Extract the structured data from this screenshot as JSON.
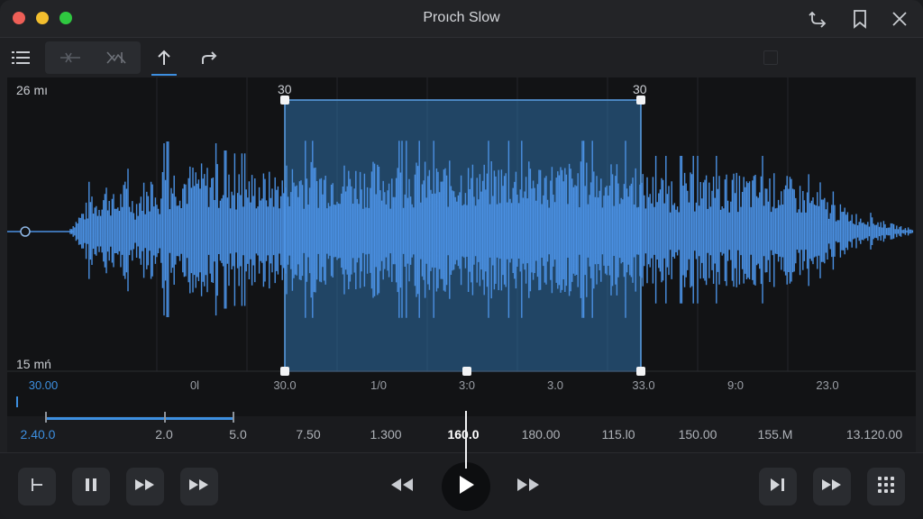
{
  "window": {
    "title": "Proıch Slow"
  },
  "titlebar_icons": [
    "route-icon",
    "bookmark-icon",
    "close-icon"
  ],
  "toolbar": {
    "items": [
      "list-icon",
      "cut-icon",
      "split-icon",
      "upload-icon",
      "redo-icon"
    ],
    "active_item": "upload-icon"
  },
  "waveform": {
    "top_level_label": "26 mı",
    "bottom_level_label": "15 mń",
    "selection_start_label": "30",
    "selection_end_label": "30",
    "timeline_labels": [
      "30.00",
      "0l",
      "30.0",
      "1/0",
      "3:0",
      "3.0",
      "33.0",
      "9:0",
      "23.0"
    ],
    "color": "#4a90e2",
    "selection_color": "#2e6fa8"
  },
  "axis": {
    "labels": [
      "2.40.0",
      "2.0",
      "5.0",
      "7.50",
      "1.300",
      "160.0",
      "180.00",
      "115.l0",
      "150.00",
      "155.M",
      "13.120.00"
    ],
    "current_label": "160.0",
    "accent": "#3d8fe0"
  },
  "transport": {
    "left_buttons": [
      "trim-start-icon",
      "pause-icon",
      "fast-forward-icon",
      "fast-forward-icon"
    ],
    "center_buttons": [
      "rewind-icon",
      "play-icon",
      "fast-forward-icon"
    ],
    "right_buttons": [
      "skip-to-end-icon",
      "fast-forward-icon",
      "grid-icon"
    ]
  }
}
